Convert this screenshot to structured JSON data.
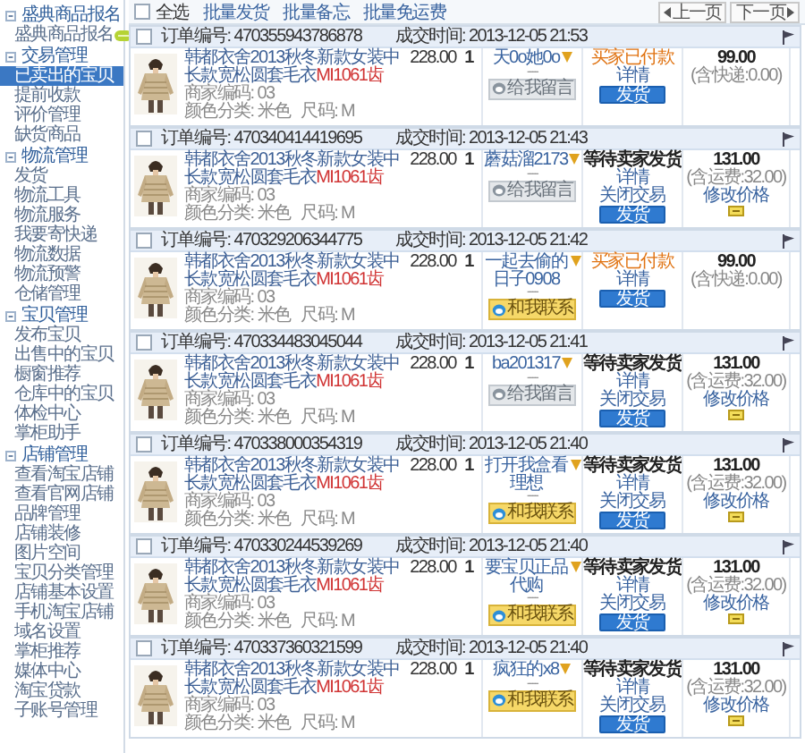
{
  "sidebar": {
    "sections": [
      {
        "title": "盛典商品报名",
        "items": [
          {
            "label": "盛典商品报名",
            "selected": false,
            "new_badge": true
          }
        ]
      },
      {
        "title": "交易管理",
        "items": [
          {
            "label": "已卖出的宝贝",
            "selected": true,
            "new_badge": false
          },
          {
            "label": "提前收款",
            "selected": false,
            "new_badge": false
          },
          {
            "label": "评价管理",
            "selected": false,
            "new_badge": false
          },
          {
            "label": "缺货商品",
            "selected": false,
            "new_badge": false
          }
        ]
      },
      {
        "title": "物流管理",
        "items": [
          {
            "label": "发货",
            "selected": false,
            "new_badge": false
          },
          {
            "label": "物流工具",
            "selected": false,
            "new_badge": false
          },
          {
            "label": "物流服务",
            "selected": false,
            "new_badge": false
          },
          {
            "label": "我要寄快递",
            "selected": false,
            "new_badge": false
          },
          {
            "label": "物流数据",
            "selected": false,
            "new_badge": false
          },
          {
            "label": "物流预警",
            "selected": false,
            "new_badge": false
          },
          {
            "label": "仓储管理",
            "selected": false,
            "new_badge": false
          }
        ]
      },
      {
        "title": "宝贝管理",
        "items": [
          {
            "label": "发布宝贝",
            "selected": false,
            "new_badge": false
          },
          {
            "label": "出售中的宝贝",
            "selected": false,
            "new_badge": false
          },
          {
            "label": "橱窗推荐",
            "selected": false,
            "new_badge": false
          },
          {
            "label": "仓库中的宝贝",
            "selected": false,
            "new_badge": false
          },
          {
            "label": "体检中心",
            "selected": false,
            "new_badge": false
          },
          {
            "label": "掌柜助手",
            "selected": false,
            "new_badge": false
          }
        ]
      },
      {
        "title": "店铺管理",
        "items": [
          {
            "label": "查看淘宝店铺",
            "selected": false,
            "new_badge": false
          },
          {
            "label": "查看官网店铺",
            "selected": false,
            "new_badge": false
          },
          {
            "label": "品牌管理",
            "selected": false,
            "new_badge": false
          },
          {
            "label": "店铺装修",
            "selected": false,
            "new_badge": false
          },
          {
            "label": "图片空间",
            "selected": false,
            "new_badge": false
          },
          {
            "label": "宝贝分类管理",
            "selected": false,
            "new_badge": false
          },
          {
            "label": "店铺基本设置",
            "selected": false,
            "new_badge": false
          },
          {
            "label": "手机淘宝店铺",
            "selected": false,
            "new_badge": false
          },
          {
            "label": "域名设置",
            "selected": false,
            "new_badge": false
          },
          {
            "label": "掌柜推荐",
            "selected": false,
            "new_badge": false
          },
          {
            "label": "媒体中心",
            "selected": false,
            "new_badge": false
          },
          {
            "label": "淘宝贷款",
            "selected": false,
            "new_badge": false
          },
          {
            "label": "子账号管理",
            "selected": false,
            "new_badge": false
          }
        ]
      }
    ]
  },
  "toolbar": {
    "select_all": {
      "label": "全选",
      "checked": false
    },
    "actions": [
      "批量发货",
      "批量备忘",
      "批量免运费"
    ],
    "pager": {
      "prev": "上一页",
      "next": "下一页"
    }
  },
  "orders": [
    {
      "checked": false,
      "order_no": "订单编号: 470355943786878",
      "time": "成交时间: 2013-12-05 21:53",
      "item": {
        "kind": "picture",
        "title": "韩都衣舍2013秋冬新款女装中长款宽松圆套毛衣",
        "code": "MI1061齿",
        "merchant_code": "商家编码: 03",
        "color_option": "颜色分类: 米色",
        "size": "尺码: M"
      },
      "price": "228.00",
      "quantity": "1",
      "buyer": {
        "name": "天0o她0o",
        "separator": "----",
        "contact": {
          "label": "给我留言",
          "online": false
        }
      },
      "status": {
        "kind": "paid",
        "text": "买家已付款",
        "links": [
          "详情"
        ],
        "button": "发货"
      },
      "total": {
        "amount": "99.00",
        "shipping": "(含快递:0.00)"
      }
    },
    {
      "checked": false,
      "order_no": "订单编号: 470340414419695",
      "time": "成交时间: 2013-12-05 21:43",
      "item": {
        "kind": "picture",
        "title": "韩都衣舍2013秋冬新款女装中长款宽松圆套毛衣",
        "code": "MI1061齿",
        "merchant_code": "商家编码: 03",
        "color_option": "颜色分类: 米色",
        "size": "尺码: M"
      },
      "price": "228.00",
      "quantity": "1",
      "buyer": {
        "name": "蘑菇溜2173",
        "separator": "----",
        "contact": {
          "label": "给我留言",
          "online": false
        }
      },
      "status": {
        "kind": "waiting",
        "text": "等待卖家发货",
        "links": [
          "详情",
          "关闭交易"
        ],
        "button": "发货"
      },
      "total": {
        "amount": "131.00",
        "shipping": "(含运费:32.00)",
        "edit_price": "修改价格"
      }
    },
    {
      "checked": false,
      "order_no": "订单编号: 470329206344775",
      "time": "成交时间: 2013-12-05 21:42",
      "item": {
        "kind": "picture",
        "title": "韩都衣舍2013秋冬新款女装中长款宽松圆套毛衣",
        "code": "MI1061齿",
        "merchant_code": "商家编码: 03",
        "color_option": "颜色分类: 米色",
        "size": "尺码: M"
      },
      "price": "228.00",
      "quantity": "1",
      "buyer": {
        "name": "一起去偷的日子0908",
        "separator": "----",
        "contact": {
          "label": "和我联系",
          "online": true
        }
      },
      "status": {
        "kind": "paid",
        "text": "买家已付款",
        "links": [
          "详情"
        ],
        "button": "发货"
      },
      "total": {
        "amount": "99.00",
        "shipping": "(含快递:0.00)"
      }
    },
    {
      "checked": false,
      "order_no": "订单编号: 470334483045044",
      "time": "成交时间: 2013-12-05 21:41",
      "item": {
        "kind": "picture",
        "title": "韩都衣舍2013秋冬新款女装中长款宽松圆套毛衣",
        "code": "MI1061齿",
        "merchant_code": "商家编码: 03",
        "color_option": "颜色分类: 米色",
        "size": "尺码: M"
      },
      "price": "228.00",
      "quantity": "1",
      "buyer": {
        "name": "ba201317",
        "separator": "----",
        "contact": {
          "label": "给我留言",
          "online": false
        }
      },
      "status": {
        "kind": "waiting",
        "text": "等待卖家发货",
        "links": [
          "详情",
          "关闭交易"
        ],
        "button": "发货"
      },
      "total": {
        "amount": "131.00",
        "shipping": "(含运费:32.00)",
        "edit_price": "修改价格"
      }
    },
    {
      "checked": false,
      "order_no": "订单编号: 470338000354319",
      "time": "成交时间: 2013-12-05 21:40",
      "item": {
        "kind": "picture",
        "title": "韩都衣舍2013秋冬新款女装中长款宽松圆套毛衣",
        "code": "MI1061齿",
        "merchant_code": "商家编码: 03",
        "color_option": "颜色分类: 米色",
        "size": "尺码: M"
      },
      "price": "228.00",
      "quantity": "1",
      "buyer": {
        "name": "打开我盒看理想",
        "separator": "----",
        "contact": {
          "label": "和我联系",
          "online": true
        }
      },
      "status": {
        "kind": "waiting",
        "text": "等待卖家发货",
        "links": [
          "详情",
          "关闭交易"
        ],
        "button": "发货"
      },
      "total": {
        "amount": "131.00",
        "shipping": "(含运费:32.00)",
        "edit_price": "修改价格"
      }
    },
    {
      "checked": false,
      "order_no": "订单编号: 470330244539269",
      "time": "成交时间: 2013-12-05 21:40",
      "item": {
        "kind": "picture",
        "title": "韩都衣舍2013秋冬新款女装中长款宽松圆套毛衣",
        "code": "MI1061齿",
        "merchant_code": "商家编码: 03",
        "color_option": "颜色分类: 米色",
        "size": "尺码: M"
      },
      "price": "228.00",
      "quantity": "1",
      "buyer": {
        "name": "要宝贝正品代购",
        "separator": "----",
        "contact": {
          "label": "和我联系",
          "online": true
        }
      },
      "status": {
        "kind": "waiting",
        "text": "等待卖家发货",
        "links": [
          "详情",
          "关闭交易"
        ],
        "button": "发货"
      },
      "total": {
        "amount": "131.00",
        "shipping": "(含运费:32.00)",
        "edit_price": "修改价格"
      }
    },
    {
      "checked": false,
      "order_no": "订单编号: 470337360321599",
      "time": "成交时间: 2013-12-05 21:40",
      "item": {
        "kind": "picture",
        "title": "韩都衣舍2013秋冬新款女装中长款宽松圆套毛衣",
        "code": "MI1061齿",
        "merchant_code": "商家编码: 03",
        "color_option": "颜色分类: 米色",
        "size": "尺码: M"
      },
      "price": "228.00",
      "quantity": "1",
      "buyer": {
        "name": "疯狂的x8",
        "separator": "----",
        "contact": {
          "label": "和我联系",
          "online": true
        }
      },
      "status": {
        "kind": "waiting",
        "text": "等待卖家发货",
        "links": [
          "详情",
          "关闭交易"
        ],
        "button": "发货"
      },
      "total": {
        "amount": "131.00",
        "shipping": "(含运费:32.00)",
        "edit_price": "修改价格"
      }
    }
  ]
}
